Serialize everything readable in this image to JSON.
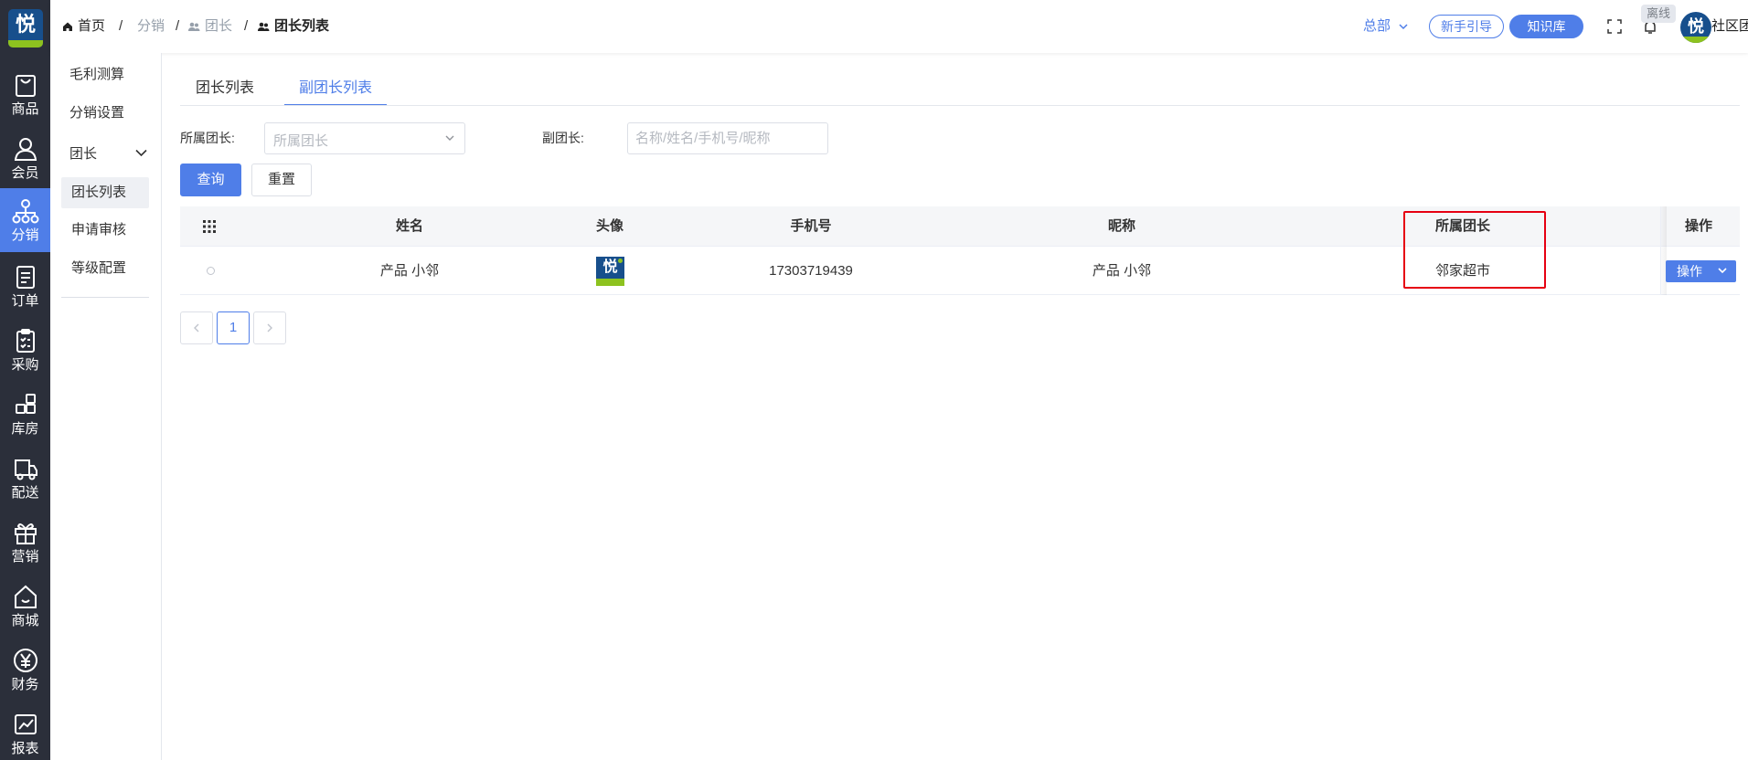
{
  "brand": {
    "logo_char": "悦",
    "primary_color": "#4f7ee8",
    "rail_color": "#2b2f3a",
    "highlight_color": "#e60012"
  },
  "rail": {
    "items": [
      {
        "label": "商品",
        "icon": "bag-icon"
      },
      {
        "label": "会员",
        "icon": "user-icon"
      },
      {
        "label": "分销",
        "icon": "network-icon",
        "active": true
      },
      {
        "label": "订单",
        "icon": "document-icon"
      },
      {
        "label": "采购",
        "icon": "clipboard-icon"
      },
      {
        "label": "库房",
        "icon": "warehouse-icon"
      },
      {
        "label": "配送",
        "icon": "truck-icon"
      },
      {
        "label": "营销",
        "icon": "gift-icon"
      },
      {
        "label": "商城",
        "icon": "home-icon"
      },
      {
        "label": "财务",
        "icon": "yen-icon"
      },
      {
        "label": "报表",
        "icon": "chart-icon"
      }
    ]
  },
  "breadcrumb": {
    "home": "首页",
    "level1": "分销",
    "level2": "团长",
    "current": "团长列表",
    "separator": "/"
  },
  "header": {
    "org": "总部",
    "guide": "新手引导",
    "knowledge": "知识库",
    "offline": "离线",
    "avatar_char": "悦",
    "user": "社区团购"
  },
  "subnav": {
    "items": [
      {
        "label": "毛利测算"
      },
      {
        "label": "分销设置"
      },
      {
        "label": "团长",
        "expanded": true
      },
      {
        "label": "团长列表",
        "active": true
      },
      {
        "label": "申请审核"
      },
      {
        "label": "等级配置"
      }
    ]
  },
  "tabs": [
    {
      "label": "团长列表"
    },
    {
      "label": "副团长列表",
      "active": true
    }
  ],
  "filters": {
    "leader_label": "所属团长:",
    "leader_placeholder": "所属团长",
    "deputy_label": "副团长:",
    "deputy_placeholder": "名称/姓名/手机号/昵称"
  },
  "buttons": {
    "query": "查询",
    "reset": "重置"
  },
  "table": {
    "columns": {
      "name": "姓名",
      "avatar": "头像",
      "phone": "手机号",
      "nickname": "昵称",
      "leader": "所属团长",
      "ops": "操作"
    },
    "rows": [
      {
        "name": "产品 小邻",
        "avatar_char": "悦",
        "phone": "17303719439",
        "nickname": "产品 小邻",
        "leader": "邻家超市",
        "op": "操作"
      }
    ]
  },
  "pagination": {
    "current": "1"
  }
}
